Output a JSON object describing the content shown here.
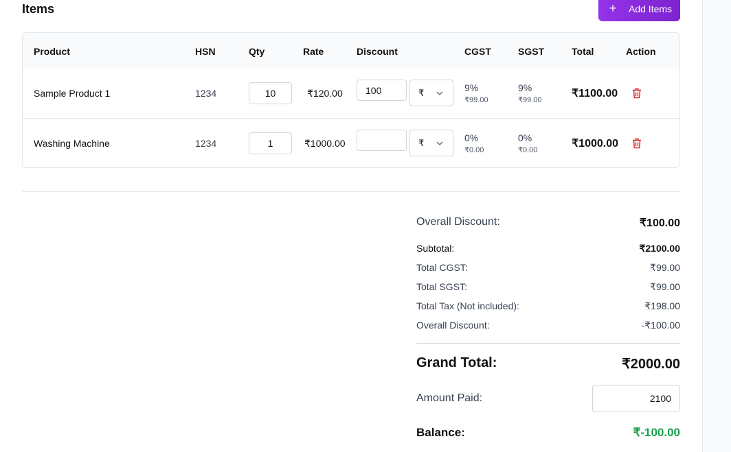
{
  "colors": {
    "accent": "#9333ea",
    "danger": "#dc2626",
    "positive_balance": "#16a34a"
  },
  "header": {
    "title": "Items",
    "add_button_icon": "plus-icon",
    "add_button_label": "Add Items"
  },
  "table": {
    "columns": [
      "Product",
      "HSN",
      "Qty",
      "Rate",
      "Discount",
      "CGST",
      "SGST",
      "Total",
      "Action"
    ],
    "rows": [
      {
        "product": "Sample Product 1",
        "hsn": "1234",
        "qty": "10",
        "rate": "₹120.00",
        "discount": "100",
        "discount_type": "₹",
        "cgst_pct": "9%",
        "cgst_amt": "₹99.00",
        "sgst_pct": "9%",
        "sgst_amt": "₹99.00",
        "total": "₹1100.00",
        "action_icon": "trash-icon"
      },
      {
        "product": "Washing Machine",
        "hsn": "1234",
        "qty": "1",
        "rate": "₹1000.00",
        "discount": "",
        "discount_type": "₹",
        "cgst_pct": "0%",
        "cgst_amt": "₹0.00",
        "sgst_pct": "0%",
        "sgst_amt": "₹0.00",
        "total": "₹1000.00",
        "action_icon": "trash-icon"
      }
    ]
  },
  "summary": {
    "overall_discount_label": "Overall Discount:",
    "overall_discount_value": "₹100.00",
    "subtotal_label": "Subtotal:",
    "subtotal_value": "₹2100.00",
    "total_cgst_label": "Total CGST:",
    "total_cgst_value": "₹99.00",
    "total_sgst_label": "Total SGST:",
    "total_sgst_value": "₹99.00",
    "total_tax_label": "Total Tax (Not included):",
    "total_tax_value": "₹198.00",
    "discount_line_label": "Overall Discount:",
    "discount_line_value": "-₹100.00",
    "grand_total_label": "Grand Total:",
    "grand_total_value": "₹2000.00",
    "amount_paid_label": "Amount Paid:",
    "amount_paid_value": "2100",
    "balance_label": "Balance:",
    "balance_value": "₹-100.00"
  }
}
